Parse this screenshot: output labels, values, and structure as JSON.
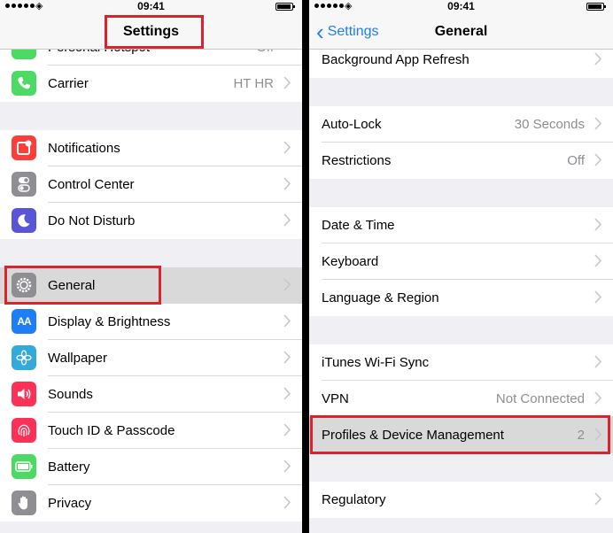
{
  "status": {
    "time": "09:41"
  },
  "left": {
    "nav_title": "Settings",
    "partial_top": {
      "label": "Personal Hotspot",
      "value": "Off"
    },
    "carrier": {
      "label": "Carrier",
      "value": "HT HR"
    },
    "group2": [
      {
        "label": "Notifications",
        "icon": "notifications-icon",
        "color": "#fc3d39"
      },
      {
        "label": "Control Center",
        "icon": "control-center-icon",
        "color": "#8e8e93"
      },
      {
        "label": "Do Not Disturb",
        "icon": "moon-icon",
        "color": "#5856d6"
      }
    ],
    "group3": [
      {
        "label": "General",
        "icon": "gear-icon",
        "color": "#8e8e93"
      },
      {
        "label": "Display & Brightness",
        "icon": "display-icon",
        "color": "#1e7ef8"
      },
      {
        "label": "Wallpaper",
        "icon": "wallpaper-icon",
        "color": "#34aadc"
      },
      {
        "label": "Sounds",
        "icon": "speaker-icon",
        "color": "#fc3158"
      },
      {
        "label": "Touch ID & Passcode",
        "icon": "fingerprint-icon",
        "color": "#fc3158"
      },
      {
        "label": "Battery",
        "icon": "battery-icon",
        "color": "#4cd964"
      },
      {
        "label": "Privacy",
        "icon": "hand-icon",
        "color": "#8e8e93"
      }
    ]
  },
  "right": {
    "back_label": "Settings",
    "nav_title": "General",
    "rows": {
      "background_refresh": {
        "label": "Background App Refresh"
      },
      "auto_lock": {
        "label": "Auto-Lock",
        "value": "30 Seconds"
      },
      "restrictions": {
        "label": "Restrictions",
        "value": "Off"
      },
      "date_time": {
        "label": "Date & Time"
      },
      "keyboard": {
        "label": "Keyboard"
      },
      "language": {
        "label": "Language & Region"
      },
      "itunes": {
        "label": "iTunes Wi-Fi Sync"
      },
      "vpn": {
        "label": "VPN",
        "value": "Not Connected"
      },
      "profiles": {
        "label": "Profiles & Device Management",
        "value": "2"
      },
      "regulatory": {
        "label": "Regulatory"
      }
    }
  },
  "colors": {
    "accent": "#1e7ef8",
    "highlight": "#d9232d",
    "background": "#efeff4"
  }
}
